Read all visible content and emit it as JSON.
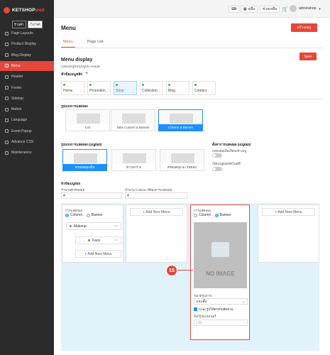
{
  "brand": {
    "name": "KETSHOP",
    "suffix": "web"
  },
  "shop_buttons": [
    "ร้านค้า",
    "เว็บไซต์"
  ],
  "sidebar": {
    "items": [
      {
        "label": "Page Layouts",
        "icon": "layout-icon"
      },
      {
        "label": "Product Display",
        "icon": "product-icon"
      },
      {
        "label": "Blog Display",
        "icon": "blog-icon"
      },
      {
        "label": "Menu",
        "icon": "menu-icon",
        "active": true
      },
      {
        "label": "Header",
        "icon": "header-icon"
      },
      {
        "label": "Footer",
        "icon": "footer-icon"
      },
      {
        "label": "Sidebar",
        "icon": "sidebar-icon"
      },
      {
        "label": "Button",
        "icon": "button-icon"
      },
      {
        "label": "Language",
        "icon": "language-icon"
      },
      {
        "label": "Event Popup",
        "icon": "popup-icon"
      },
      {
        "label": "Advance CSS",
        "icon": "css-icon"
      },
      {
        "label": "Maintenance",
        "icon": "maintenance-icon"
      }
    ]
  },
  "topbar": {
    "b1": "⌨",
    "b2": "คู่มือ",
    "b3": "ช่วยเหลือ",
    "user": "adminshop"
  },
  "page": {
    "title": "Menu",
    "create_label": "สร้างเมนู",
    "tabs": [
      "Menu",
      "Page List"
    ]
  },
  "menu_display": {
    "title": "Menu display",
    "subtitle": "แสดงเมนูของเมนูบน Header",
    "save": "Save",
    "main_menu_label": "หัวข้อเมนูหลัก",
    "add": "+"
  },
  "menu_tabs": [
    "Home",
    "Promotion",
    "Shop",
    "Collection",
    "Blog",
    "Contact"
  ],
  "style_label": "รูปแบบการแสดงผล",
  "styles": [
    "List",
    "Tabs Column & Banner",
    "Column & Banner"
  ],
  "sub_style_label": "รูปแบบการแสดงผล (เมนูย่อย)",
  "sub_styles": [
    "ครอบคลุมเต็ม",
    "ความกว้าง",
    "ครอบคลุม & เว้นขอบ"
  ],
  "sub_settings": {
    "title": "ตั้งค่าการแสดงผล (เมนูย่อย)",
    "opt1": "แสดงผลเมื่อเลื่อนเข้าเมนู",
    "opt2": "เปิดเมนูย่อยอัตโนมัติ"
  },
  "sub_title": "หัวข้อเมนูย่อย",
  "fields": {
    "count_label": "จำนวนหัวข้อย่อย",
    "count_value": "4",
    "cols_label": "จำนวน Column ที่ต้องการแสดงผล",
    "cols_value": "4"
  },
  "columns": {
    "type_label": "การแสดงผล",
    "column": "Column",
    "banner": "Banner",
    "add_menu": "+ Add New Menu",
    "item1": "Makeup",
    "item2": "Face"
  },
  "banner": {
    "type_label": "การแสดงผล",
    "noimage": "NO IMAGE",
    "size_label": "ขนาดรูปภาพ",
    "size_value": "แนวตั้ง",
    "crop_label": "Crop รูปให้ตรงกับสัดส่วน",
    "link_label": "ลิงก์รูปแบนเนอร์",
    "link_placeholder": "URL"
  },
  "annotation": "15"
}
